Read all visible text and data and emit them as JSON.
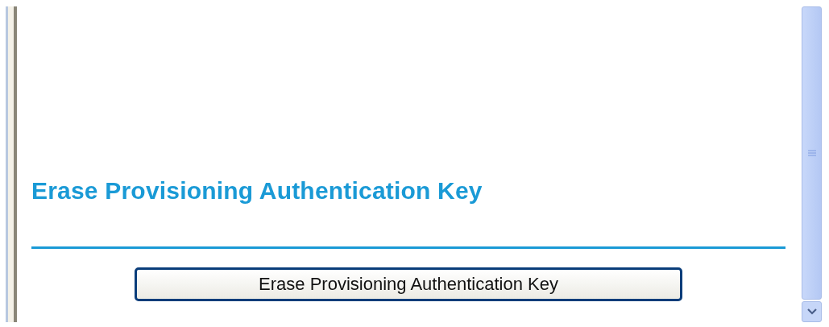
{
  "section": {
    "heading": "Erase Provisioning Authentication Key"
  },
  "button": {
    "label": "Erase Provisioning Authentication Key"
  }
}
